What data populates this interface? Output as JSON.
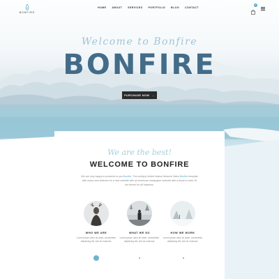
{
  "brand": {
    "name": "BONFIRE"
  },
  "nav": {
    "items": [
      "HOME",
      "ABOUT",
      "SERVICES",
      "PORTFOLIO",
      "BLOG",
      "CONTACT"
    ],
    "cart_count": "0"
  },
  "hero": {
    "script_title": "Welcome to Bonfire",
    "title": "BONFIRE",
    "button_label": "PURCHASE NOW",
    "button_arrow": "→"
  },
  "intro": {
    "script_title": "We are the best!",
    "title": "WELCOME TO BONFIRE",
    "text_1": "We are very happy to presents to you ",
    "link_1": "Bonfire",
    "text_2": ". The multiply United Nacha Network Sales ",
    "link_2": "Bonfire",
    "text_3": " template with many new features for a nice website with an American newspaper website with a block to build 16 set theme for all business."
  },
  "features": [
    {
      "title": "WHO WE ARE",
      "text": "Lorem ipsum dolor sit amet, consectetur adipiscing elit, sed do eiusmod."
    },
    {
      "title": "WHAT WE DO",
      "text": "Lorem ipsum dolor sit amet, consectetur adipiscing elit, sed do eiusmod."
    },
    {
      "title": "HOW WE WORK",
      "text": "Lorem ipsum dolor sit amet, consectetur adipiscing elit, sed do eiusmod."
    }
  ],
  "colors": {
    "accent": "#5aa9c9",
    "dark": "#2b2b2b",
    "title_blue": "#2c5a7a"
  },
  "icons": {
    "cart": "shopping-bag-icon",
    "menu": "hamburger-icon",
    "scroll": "arrow-down-icon"
  }
}
